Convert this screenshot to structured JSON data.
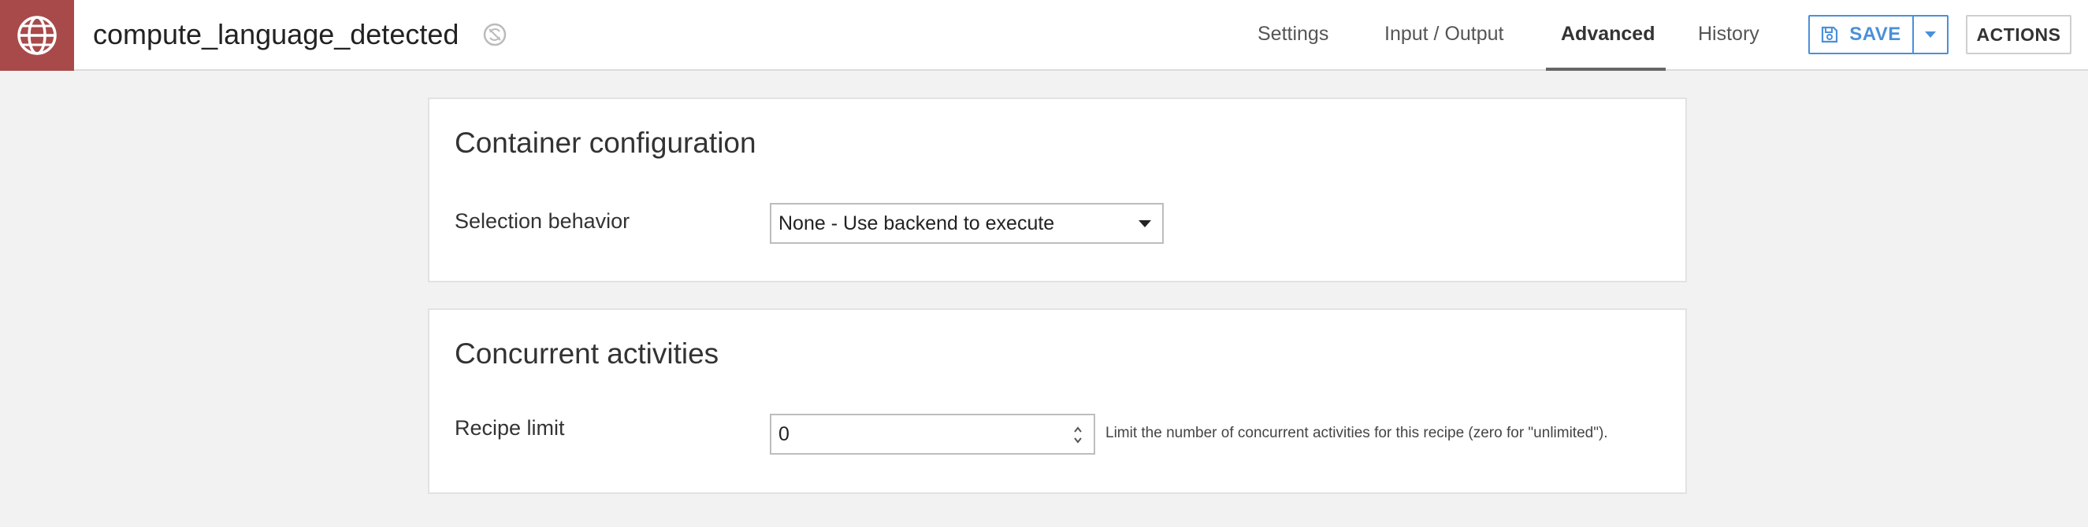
{
  "header": {
    "recipe_name": "compute_language_detected",
    "recipe_icon": "globe-icon",
    "status_icon": "sync-disabled-icon",
    "accent_color": "#a84a4a"
  },
  "tabs": [
    {
      "label": "Settings",
      "active": false
    },
    {
      "label": "Input / Output",
      "active": false
    },
    {
      "label": "Advanced",
      "active": true
    },
    {
      "label": "History",
      "active": false
    }
  ],
  "toolbar": {
    "save_label": "SAVE",
    "save_icon": "floppy-disk-icon",
    "save_color": "#4a90d9",
    "actions_label": "ACTIONS"
  },
  "container_config": {
    "title": "Container configuration",
    "selection_label": "Selection behavior",
    "selection_value": "None - Use backend to execute"
  },
  "concurrent": {
    "title": "Concurrent activities",
    "limit_label": "Recipe limit",
    "limit_value": "0",
    "help": "Limit the number of concurrent activities for this recipe (zero for \"unlimited\")."
  }
}
